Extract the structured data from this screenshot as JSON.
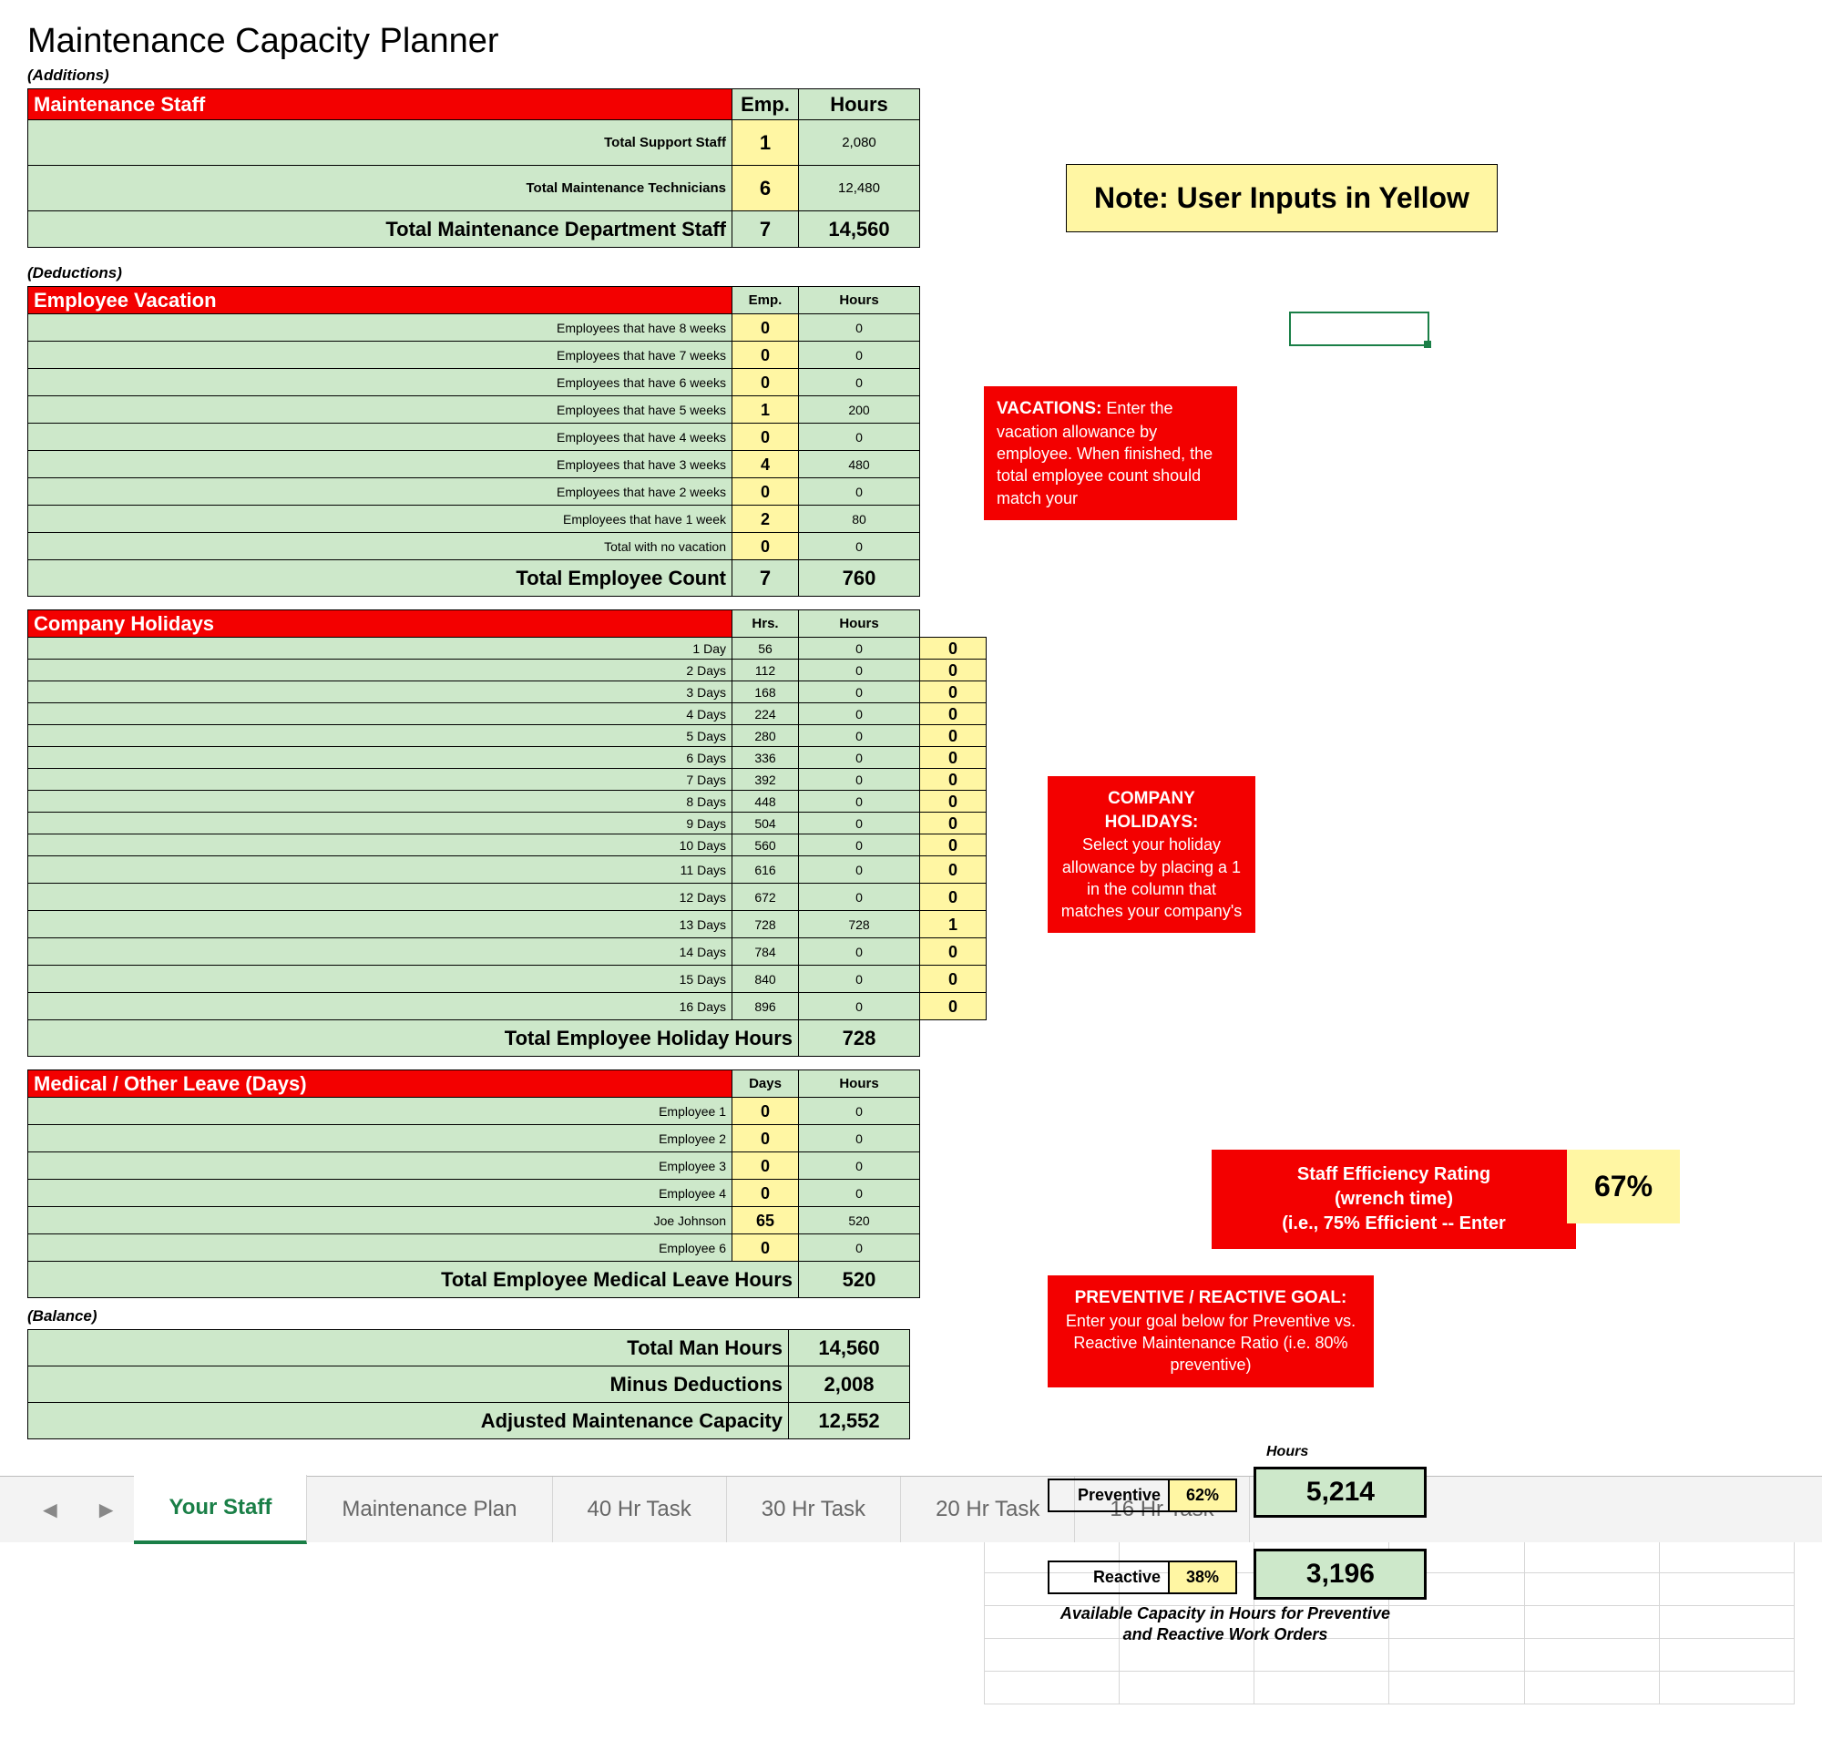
{
  "title": "Maintenance Capacity Planner",
  "headings": {
    "additions": "(Additions)",
    "deductions": "(Deductions)",
    "balance": "(Balance)"
  },
  "cols": {
    "emp": "Emp.",
    "hrs": "Hrs.",
    "hours": "Hours",
    "days": "Days"
  },
  "note": "Note: User Inputs in Yellow",
  "staff": {
    "header": "Maintenance Staff",
    "rows": [
      {
        "label": "Total Support Staff",
        "emp": "1",
        "hours": "2,080"
      },
      {
        "label": "Total Maintenance Technicians",
        "emp": "6",
        "hours": "12,480"
      }
    ],
    "total": {
      "label": "Total Maintenance Department Staff",
      "emp": "7",
      "hours": "14,560"
    }
  },
  "vacation": {
    "header": "Employee Vacation",
    "rows": [
      {
        "label": "Employees that have 8 weeks",
        "emp": "0",
        "hours": "0"
      },
      {
        "label": "Employees that have 7 weeks",
        "emp": "0",
        "hours": "0"
      },
      {
        "label": "Employees that have 6 weeks",
        "emp": "0",
        "hours": "0"
      },
      {
        "label": "Employees that have 5 weeks",
        "emp": "1",
        "hours": "200"
      },
      {
        "label": "Employees that have 4 weeks",
        "emp": "0",
        "hours": "0"
      },
      {
        "label": "Employees that have 3 weeks",
        "emp": "4",
        "hours": "480"
      },
      {
        "label": "Employees that have 2 weeks",
        "emp": "0",
        "hours": "0"
      },
      {
        "label": "Employees that have 1 week",
        "emp": "2",
        "hours": "80"
      },
      {
        "label": "Total with no vacation",
        "emp": "0",
        "hours": "0"
      }
    ],
    "total": {
      "label": "Total  Employee Count",
      "emp": "7",
      "hours": "760"
    },
    "info": {
      "hdr": "VACATIONS:",
      "body": "Enter the vacation allowance by employee.  When finished, the total employee count should match your"
    }
  },
  "holidays": {
    "header": "Company Holidays",
    "rows": [
      {
        "label": "1 Day",
        "hrs": "56",
        "hours": "0",
        "sel": "0"
      },
      {
        "label": "2 Days",
        "hrs": "112",
        "hours": "0",
        "sel": "0"
      },
      {
        "label": "3 Days",
        "hrs": "168",
        "hours": "0",
        "sel": "0"
      },
      {
        "label": "4 Days",
        "hrs": "224",
        "hours": "0",
        "sel": "0"
      },
      {
        "label": "5 Days",
        "hrs": "280",
        "hours": "0",
        "sel": "0"
      },
      {
        "label": "6 Days",
        "hrs": "336",
        "hours": "0",
        "sel": "0"
      },
      {
        "label": "7 Days",
        "hrs": "392",
        "hours": "0",
        "sel": "0"
      },
      {
        "label": "8 Days",
        "hrs": "448",
        "hours": "0",
        "sel": "0"
      },
      {
        "label": "9 Days",
        "hrs": "504",
        "hours": "0",
        "sel": "0"
      },
      {
        "label": "10 Days",
        "hrs": "560",
        "hours": "0",
        "sel": "0"
      },
      {
        "label": "11 Days",
        "hrs": "616",
        "hours": "0",
        "sel": "0"
      },
      {
        "label": "12 Days",
        "hrs": "672",
        "hours": "0",
        "sel": "0"
      },
      {
        "label": "13 Days",
        "hrs": "728",
        "hours": "728",
        "sel": "1"
      },
      {
        "label": "14 Days",
        "hrs": "784",
        "hours": "0",
        "sel": "0"
      },
      {
        "label": "15 Days",
        "hrs": "840",
        "hours": "0",
        "sel": "0"
      },
      {
        "label": "16 Days",
        "hrs": "896",
        "hours": "0",
        "sel": "0"
      }
    ],
    "total": {
      "label": "Total  Employee Holiday Hours",
      "hours": "728"
    },
    "info": {
      "hdr": "COMPANY HOLIDAYS:",
      "body": "Select your holiday allowance by placing a 1 in the column that matches your company's"
    }
  },
  "medical": {
    "header": "Medical / Other Leave (Days)",
    "rows": [
      {
        "label": "Employee 1",
        "days": "0",
        "hours": "0"
      },
      {
        "label": "Employee 2",
        "days": "0",
        "hours": "0"
      },
      {
        "label": "Employee 3",
        "days": "0",
        "hours": "0"
      },
      {
        "label": "Employee 4",
        "days": "0",
        "hours": "0"
      },
      {
        "label": "Joe Johnson",
        "days": "65",
        "hours": "520"
      },
      {
        "label": "Employee 6",
        "days": "0",
        "hours": "0"
      }
    ],
    "total": {
      "label": "Total  Employee Medical Leave Hours",
      "hours": "520"
    }
  },
  "efficiency": {
    "lines": [
      "Staff Efficiency Rating",
      "(wrench time)",
      "(i.e., 75% Efficient -- Enter"
    ],
    "value": "67%"
  },
  "goal": {
    "hdr": "PREVENTIVE / REACTIVE GOAL:",
    "body": "Enter your goal below for Preventive vs. Reactive Maintenance Ratio (i.e. 80% preventive)",
    "hoursLabel": "Hours",
    "preventive": {
      "label": "Preventive",
      "pct": "62%",
      "value": "5,214"
    },
    "reactive": {
      "label": "Reactive",
      "pct": "38%",
      "value": "3,196"
    },
    "footnote": "Available Capacity in Hours for Preventive and Reactive Work Orders"
  },
  "balance": {
    "rows": [
      {
        "label": "Total Man Hours",
        "value": "14,560"
      },
      {
        "label": "Minus Deductions",
        "value": "2,008"
      },
      {
        "label": "Adjusted Maintenance Capacity",
        "value": "12,552"
      }
    ]
  },
  "tabs": [
    "Your Staff",
    "Maintenance Plan",
    "40 Hr Task",
    "30 Hr Task",
    "20 Hr Task",
    "16 Hr Task"
  ],
  "activeTab": 0
}
